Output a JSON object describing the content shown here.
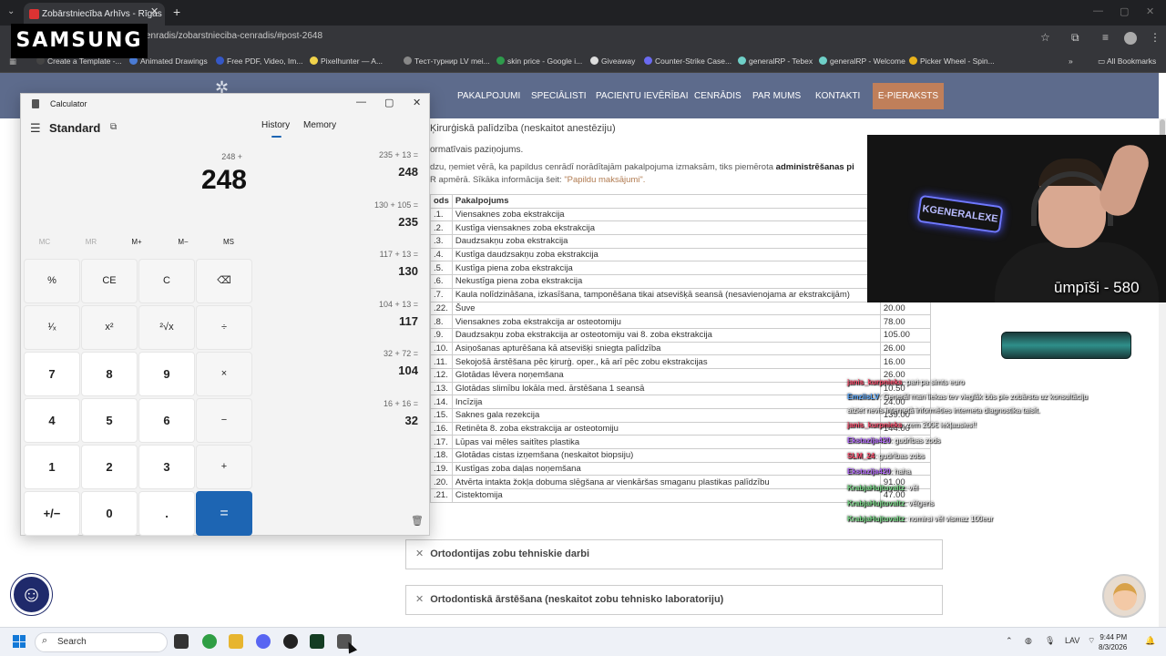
{
  "browser": {
    "tab_title": "Zobārstniecība Arhīvs - Rīgas 1",
    "url": "enradis/zobarstnieciba-cenradis/#post-2648",
    "bookmarks": [
      "Create a Template -...",
      "Animated Drawings",
      "Free PDF, Video, Im...",
      "Pixelhunter — A...",
      "Тест-турнир LV mei...",
      "skin price - Google i...",
      "Giveaway",
      "Counter-Strike Case...",
      "generalRP - Tebex",
      "generalRP - Welcome",
      "Picker Wheel - Spin..."
    ],
    "all_bookmarks": "All Bookmarks"
  },
  "overlay_brand": "SAMSUNG",
  "site": {
    "nav": [
      "PAKALPOJUMI",
      "SPECIĀLISTI",
      "PACIENTU IEVĒRĪBAI",
      "CENRĀDIS",
      "PAR MUMS",
      "KONTAKTI"
    ],
    "cta": "E-PIERAKSTS",
    "section_title": "Ķirurģiskā palīdzība (neskaitot anestēziju)",
    "info_title": "ormatīvais paziņojums.",
    "info_text_pre": "dzu, ņemiet vērā, ka papildus cenrādī norādītajām pakalpojuma izmaksām, tiks piemērota ",
    "info_text_bold": "administrēšanas pi",
    "info_text2_pre": "R apmērā. Sīkāka informācija šeit: ",
    "info_link": "\"Papildu maksājumi\".",
    "table_head": [
      "ods",
      "Pakalpojums",
      ""
    ],
    "rows": [
      [
        ".1.",
        "Viensaknes zoba ekstrakcija",
        ""
      ],
      [
        ".2.",
        "Kustīga viensaknes zoba ekstrakcija",
        ""
      ],
      [
        ".3.",
        "Daudzsakņu zoba ekstrakcija",
        ""
      ],
      [
        ".4.",
        "Kustīga daudzsakņu zoba ekstrakcija",
        ""
      ],
      [
        ".5.",
        "Kustīga piena zoba ekstrakcija",
        ""
      ],
      [
        ".6.",
        "Nekustīga piena zoba ekstrakcija",
        ""
      ],
      [
        ".7.",
        "Kaula nolīdzināšana, izkasīšana, tamponēšana tikai atsevišķā seansā (nesavienojama ar ekstrakcijām)",
        ""
      ],
      [
        ".22.",
        "Šuve",
        "20.00"
      ],
      [
        ".8.",
        "Viensaknes zoba ekstrakcija ar osteotomiju",
        "78.00"
      ],
      [
        ".9.",
        "Daudzsakņu zoba ekstrakcija ar osteotomiju vai 8. zoba ekstrakcija",
        "105.00"
      ],
      [
        ".10.",
        "Asiņošanas apturēšana kā atsevišķi sniegta palīdzība",
        "26.00"
      ],
      [
        ".11.",
        "Sekojošā ārstēšana pēc ķirurģ. oper., kā arī pēc zobu ekstrakcijas",
        "16.00"
      ],
      [
        ".12.",
        "Glotādas lēvera noņemšana",
        "26.00"
      ],
      [
        ".13.",
        "Glotādas slimību lokāla med. ārstēšana 1 seansā",
        "10.50"
      ],
      [
        ".14.",
        "Incīzija",
        "24.00"
      ],
      [
        ".15.",
        "Saknes gala rezekcija",
        "139.00"
      ],
      [
        ".16.",
        "Retinēta 8. zoba ekstrakcija ar osteotomiju",
        "144.00"
      ],
      [
        ".17.",
        "Lūpas vai mēles saitītes plastika",
        ""
      ],
      [
        ".18.",
        "Glotādas cistas izņemšana (neskaitot biopsiju)",
        ""
      ],
      [
        ".19.",
        "Kustīgas zoba daļas noņemšana",
        ""
      ],
      [
        ".20.",
        "Atvērta intakta žokļa dobuma slēgšana ar vienkāršas smaganu plastikas palīdzību",
        "91.00"
      ],
      [
        ".21.",
        "Cistektomija",
        "47.00"
      ]
    ],
    "accordions": [
      "Ortodontijas zobu tehniskie darbi",
      "Ortodontiskā ārstēšana (neskaitot zobu tehnisko laboratoriju)"
    ]
  },
  "stream": {
    "neon_sign": "KGENERALEXE",
    "counter": "ūmpīši - 580",
    "chat": [
      {
        "user": "janis_kurpnieks",
        "msg": ": pari pa simts euro",
        "color": "#ff4d6d"
      },
      {
        "user": "EmziisLV",
        "msg": ": Generāl man liekas tev vieglāk būs pie zobārsta uz konsultāciju",
        "color": "#5aa9ff"
      },
      {
        "user": "",
        "msg": "aiziet nevis internetā informēties interneta diagnostika taisīt.",
        "color": "#ffffff"
      },
      {
        "user": "janis_kurpnieks",
        "msg": ": zem 200€ iekļausies!!",
        "color": "#ff4d6d"
      },
      {
        "user": "Ekstazija420",
        "msg": ": gudrības zods",
        "color": "#b66bff"
      },
      {
        "user": "SLM_24",
        "msg": ": gudrības zobs",
        "color": "#ff4d6d"
      },
      {
        "user": "Ekstazija420",
        "msg": ": haha",
        "color": "#b66bff"
      },
      {
        "user": "KrabjaHujtuvaltz",
        "msg": ": vēl",
        "color": "#7bdc8a"
      },
      {
        "user": "KrabjaHujtuvaltz",
        "msg": ": vēlgens",
        "color": "#7bdc8a"
      },
      {
        "user": "KrabjaHujtuvaltz",
        "msg": ": nomirsi vēl vismaz 100eur",
        "color": "#7bdc8a"
      }
    ]
  },
  "calculator": {
    "title": "Calculator",
    "mode": "Standard",
    "expression": "248 +",
    "display": "248",
    "tabs": [
      "History",
      "Memory"
    ],
    "memory_keys": [
      "MC",
      "MR",
      "M+",
      "M−",
      "MS"
    ],
    "keys": [
      [
        "%",
        "CE",
        "C",
        "⌫"
      ],
      [
        "¹⁄ₓ",
        "x²",
        "²√x",
        "÷"
      ],
      [
        "7",
        "8",
        "9",
        "×"
      ],
      [
        "4",
        "5",
        "6",
        "−"
      ],
      [
        "1",
        "2",
        "3",
        "+"
      ],
      [
        "+/−",
        "0",
        ".",
        "="
      ]
    ],
    "history": [
      {
        "expr": "235  +  13 =",
        "result": "248"
      },
      {
        "expr": "130  +  105 =",
        "result": "235"
      },
      {
        "expr": "117  +  13 =",
        "result": "130"
      },
      {
        "expr": "104  +  13 =",
        "result": "117"
      },
      {
        "expr": "32  +  72 =",
        "result": "104"
      },
      {
        "expr": "16  +  16 =",
        "result": "32"
      }
    ]
  },
  "taskbar": {
    "search": "Search",
    "lang": "LAV",
    "time": "9:44 PM",
    "date": "8/3/2026"
  }
}
